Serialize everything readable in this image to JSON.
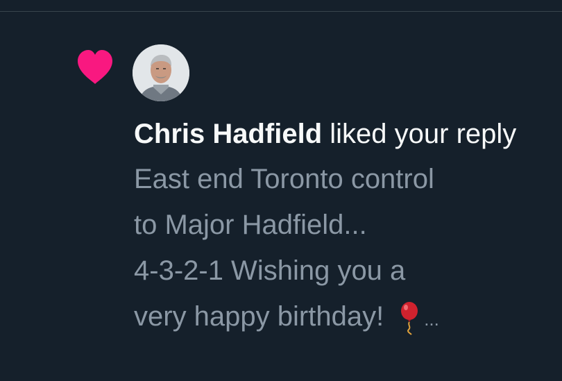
{
  "notification": {
    "type_icon": "heart-icon",
    "type_color": "#f91880",
    "actor_name": "Chris Hadfield",
    "action_text": " liked your reply",
    "reply_text": "East end Toronto control\nto Major Hadfield...\n4-3-2-1 Wishing you a\nvery happy birthday!",
    "reply_emoji": "balloon-icon",
    "truncation": "..."
  },
  "colors": {
    "background": "#15202b",
    "primary_text": "#f7f9f9",
    "secondary_text": "#8b98a5",
    "divider": "#38444d"
  }
}
